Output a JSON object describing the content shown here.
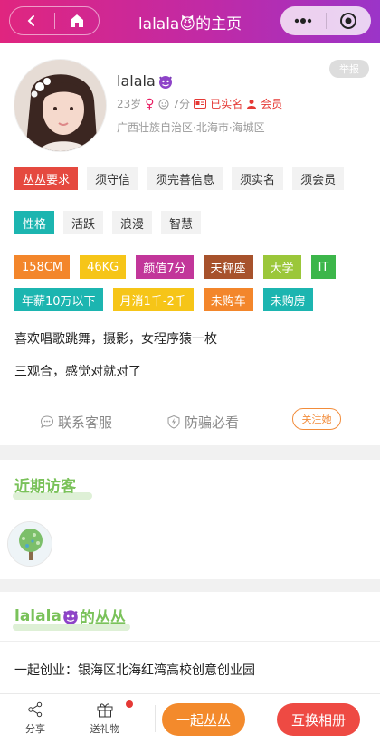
{
  "header": {
    "title": "lalala😈的主页"
  },
  "profile": {
    "report_label": "举报",
    "name": "lalala",
    "age": "23岁",
    "score": "7分",
    "verified_label": "已实名",
    "member_label": "会员",
    "location": "广西壮族自治区·北海市·海城区"
  },
  "requirements": {
    "label": "丛丛要求",
    "items": [
      "须守信",
      "须完善信息",
      "须实名",
      "须会员"
    ]
  },
  "personality": {
    "label": "性格",
    "items": [
      "活跃",
      "浪漫",
      "智慧"
    ]
  },
  "attributes": {
    "row1": [
      "158CM",
      "46KG",
      "颜值7分",
      "天秤座",
      "大学",
      "IT"
    ],
    "row2": [
      "年薪10万以下",
      "月消1千-2千",
      "未购车",
      "未购房"
    ]
  },
  "bio": {
    "line1": "喜欢唱歌跳舞，摄影，女程序猿一枚",
    "line2": "三观合，感觉对就对了"
  },
  "actions": {
    "service": "联系客服",
    "antifraud": "防骗必看",
    "follow": "关注她"
  },
  "visitors": {
    "title": "近期访客"
  },
  "congcong": {
    "title_name": "lalala",
    "title_suffix": "的丛丛",
    "item": "一起创业：银海区北海红湾高校创意创业园"
  },
  "bottom": {
    "share": "分享",
    "gift": "送礼物",
    "join": "一起丛丛",
    "exchange": "互换相册"
  },
  "colors": {
    "header_start": "#e0257f",
    "header_end": "#9b34c8",
    "requirements_tag": "#e5493f",
    "personality_tag": "#1cb5b0",
    "accent_green": "#7ac25a",
    "button_orange": "#f38a2c",
    "button_red": "#ee4a43"
  }
}
